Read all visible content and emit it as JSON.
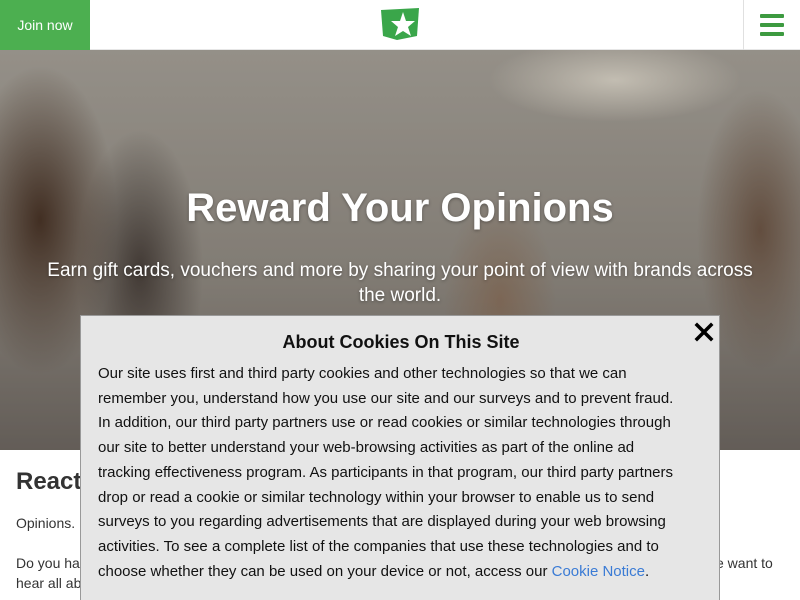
{
  "header": {
    "join_label": "Join now",
    "logo_icon": "star-logo-icon",
    "menu_icon": "hamburger-menu-icon"
  },
  "hero": {
    "title": "Reward Your Opinions",
    "subtitle": "Earn gift cards, vouchers and more by sharing your point of view with brands across the world."
  },
  "content": {
    "heading_visible": "React",
    "line1_visible": "Opinions.",
    "para_left_visible": "Do you ha",
    "para_left2_visible": "hear all ab",
    "para_right_visible": "e want to"
  },
  "cookie_modal": {
    "title": "About Cookies On This Site",
    "body": "Our site uses first and third party cookies and other technologies so that we can remember you, understand how you use our site and our surveys and to prevent fraud. In addition, our third party partners use or read cookies or similar technologies through our site to better understand your web-browsing activities as part of the online ad tracking effectiveness program. As participants in that program, our third party partners drop or read a cookie or similar technology within your browser to enable us to send surveys to you regarding advertisements that are displayed during your web browsing activities. To see a complete list of the companies that use these technologies and to choose whether they can be used on your device or not, access our ",
    "link_label": "Cookie Notice",
    "body_end": ".",
    "close_icon": "close-icon"
  },
  "colors": {
    "brand_green": "#4caf50",
    "menu_green": "#3d9a40",
    "link_blue": "#3a7bd5",
    "modal_bg": "#e6e6e6"
  }
}
